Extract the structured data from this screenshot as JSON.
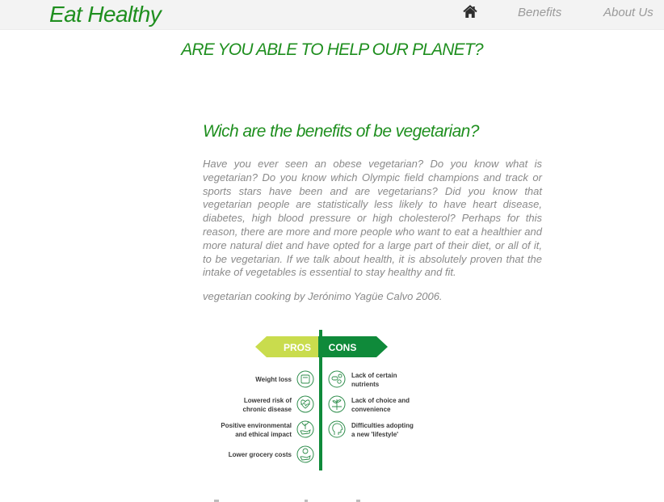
{
  "navbar": {
    "brand": "Eat Healthy",
    "home_icon": "home-icon",
    "links": [
      "Benefits",
      "About Us"
    ]
  },
  "hero": {
    "title": "ARE YOU ABLE TO HELP OUR PLANET?"
  },
  "article": {
    "title": "Wich are the benefits of be vegetarian?",
    "body": "Have you ever seen an obese vegetarian? Do you know what is vegetarian? Do you know which Olympic field champions and track or sports stars have been and are vegetarians? Did you know that vegetarian people are statistically less likely to have heart disease, diabetes, high blood pressure or high cholesterol? Perhaps for this reason, there are more and more people who want to eat a healthier and more natural diet and have opted for a large part of their diet, or all of it, to be vegetarian. If we talk about health, it is absolutely proven that the intake of vegetables is essential to stay healthy and fit.",
    "citation": "vegetarian cooking by Jerónimo Yagüe Calvo 2006."
  },
  "infographic": {
    "pros_label": "PROS",
    "cons_label": "CONS",
    "pros": [
      {
        "lines": [
          "Weight loss"
        ],
        "icon": "scale-icon"
      },
      {
        "lines": [
          "Lowered risk of",
          "chronic disease"
        ],
        "icon": "heart-pulse-icon"
      },
      {
        "lines": [
          "Positive environmental",
          "and ethical impact"
        ],
        "icon": "hand-sprout-icon"
      },
      {
        "lines": [
          "Lower grocery costs"
        ],
        "icon": "hand-coin-icon"
      }
    ],
    "cons": [
      {
        "lines": [
          "Lack of certain",
          "nutrients"
        ],
        "icon": "pills-icon"
      },
      {
        "lines": [
          "Lack of choice and",
          "convenience"
        ],
        "icon": "sprout-icon"
      },
      {
        "lines": [
          "Difficulties adopting",
          "a new 'lifestyle'"
        ],
        "icon": "head-icon"
      }
    ],
    "colors": {
      "pros": "#c9dc4d",
      "cons": "#0f8a3a",
      "icon_stroke": "#2c8c4a",
      "text": "#3a3a3a"
    }
  }
}
